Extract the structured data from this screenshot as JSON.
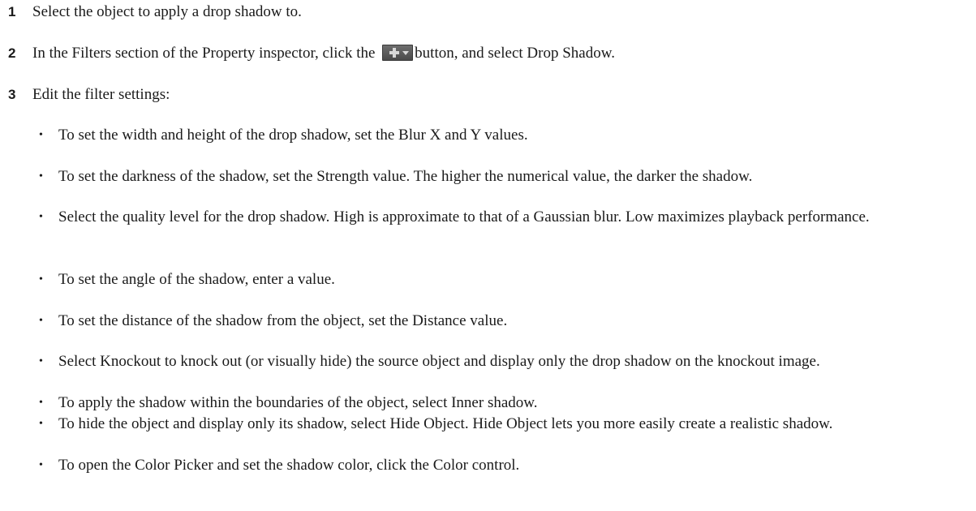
{
  "steps": [
    {
      "number": "1",
      "text": "Select the object to apply a drop shadow to."
    },
    {
      "number": "2",
      "text_before": "In the Filters section of the Property inspector, click the",
      "text_after": "button, and select Drop Shadow.",
      "button_icon": "add-filter-plus-dropdown-icon"
    },
    {
      "number": "3",
      "text": "Edit the filter settings:"
    }
  ],
  "bullets": [
    "To set the width and height of the drop shadow, set the Blur X and Y values.",
    "To set the darkness of the shadow, set the Strength value. The higher the numerical value, the darker the shadow.",
    "Select the quality level for the drop shadow. High is approximate to that of a Gaussian blur. Low maximizes playback performance.",
    "To set the angle of the shadow, enter a value.",
    "To set the distance of the shadow from the object, set the Distance value.",
    "Select Knockout to knock out (or visually hide) the source object and display only the drop shadow on the knockout image.",
    "To apply the shadow within the boundaries of the object, select Inner shadow.",
    "To hide the object and display only its shadow, select Hide Object. Hide Object lets you more easily create a realistic shadow.",
    "To open the Color Picker and set the shadow color, click the Color control."
  ],
  "bullet_symbol": "•",
  "colors": {
    "text": "#1a1a1a",
    "button_bg": "#5a5a5a",
    "button_icon": "#d8d8d8"
  }
}
